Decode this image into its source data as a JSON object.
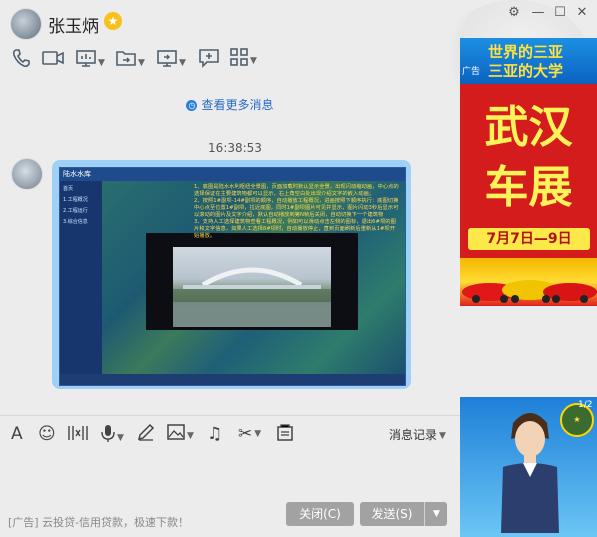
{
  "header": {
    "contact_name": "张玉炳",
    "window_controls": [
      "settings-icon",
      "minimize-icon",
      "maximize-icon",
      "close-icon"
    ]
  },
  "toolbar": {
    "items": [
      "phone-icon",
      "video-icon",
      "screen-share-icon",
      "file-transfer-icon",
      "remote-desktop-icon",
      "whiteboard-icon",
      "apps-icon"
    ]
  },
  "chat": {
    "more_messages_label": "查看更多消息",
    "timestamp": "16:38:53",
    "image_message": {
      "logo": "陆水水库",
      "sidebar_items": [
        "首页",
        "1.工程概况",
        "2.工程运行",
        "3.综合信息"
      ],
      "caption_lines": [
        "1、底图是陆水水利枢纽全景图，页面加载时默认显示全景，出现闪动缩动画，中心点的选择保证在主要建筑物都可以显示，右上角空白处出现介绍文字的嵌入动画；",
        "2、按照1#副坝-14#副坝的顺序，自动播放工程概况，进画按照下顺序执行：底图切换中心点至位置1#副坝，拉近底图，同时1#副坝图片可见并显示，图片闪动3秒后显示可以滚动的图片及文字介绍，默认自动播放到第N帧后关闭，自动切换下一个建筑物",
        "3、支持人工选择建筑物查看工程概况，例如可以滑动点击左侧的图标，退出6#坝的图片和文字信息，如果人工选择8#坝时，自动播放停止，直到页面刷新后重新从1#坝开始播放。"
      ]
    }
  },
  "input_toolbar": {
    "items": [
      "font-icon",
      "emoji-icon",
      "screenshot-icon",
      "voice-icon",
      "pen-icon",
      "image-icon",
      "music-icon",
      "scissors-icon",
      "bag-icon"
    ],
    "history_label": "消息记录"
  },
  "footer": {
    "ad_text": "[广告] 云投贷-信用贷款，极速下款！",
    "close_label": "关闭(C)",
    "send_label": "发送(S)"
  },
  "ads": {
    "top": {
      "line1": "世界的三亚",
      "line2": "三亚的大学",
      "tag": "广告",
      "headline1": "武汉",
      "headline2": "车展",
      "date": "7月7日—9日"
    },
    "bottom": {
      "counter": "1/2"
    }
  },
  "colors": {
    "bubble": "#9fd0f6",
    "link": "#2a6bc4",
    "ad_red": "#d41c1c",
    "ad_yellow": "#fff35a"
  }
}
